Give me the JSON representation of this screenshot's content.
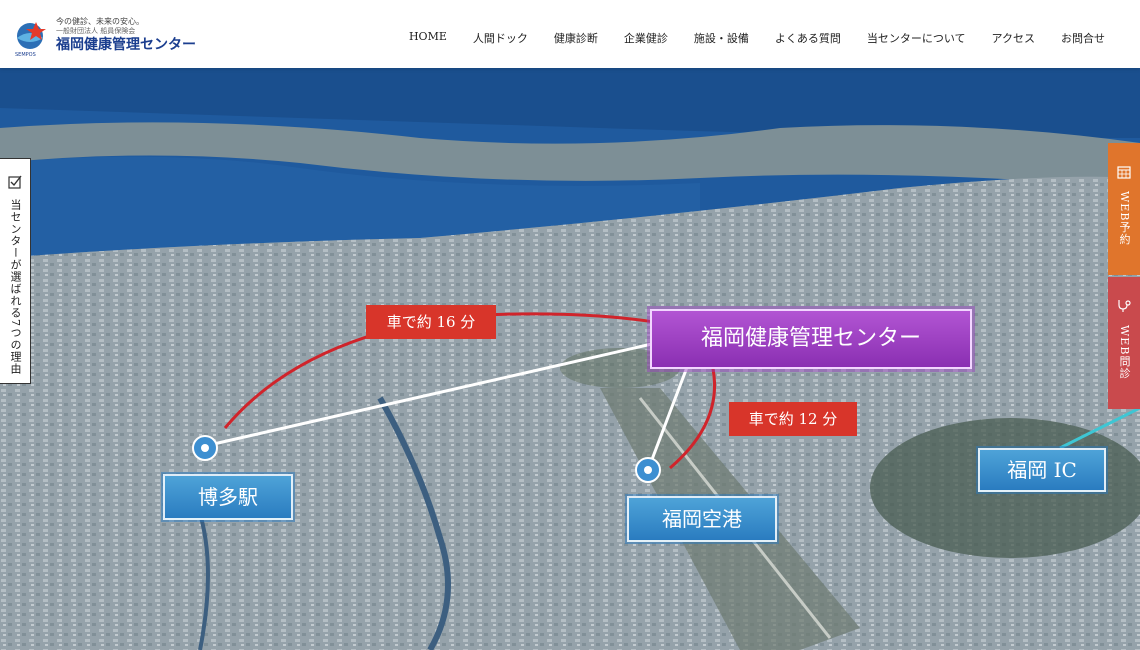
{
  "header": {
    "tagline": "今の健診、未来の安心。",
    "org": "一般財団法人 船員保険会",
    "brand": "福岡健康管理センター",
    "logo_caption": "SEMPOS"
  },
  "nav": [
    {
      "label": "HOME"
    },
    {
      "label": "人間ドック"
    },
    {
      "label": "健康診断"
    },
    {
      "label": "企業健診"
    },
    {
      "label": "施設・設備"
    },
    {
      "label": "よくある質問"
    },
    {
      "label": "当センターについて"
    },
    {
      "label": "アクセス"
    },
    {
      "label": "お問合せ"
    }
  ],
  "side_tab": {
    "label": "当センターが選ばれる7つの理由"
  },
  "right_tabs": [
    {
      "label": "WEB予約",
      "icon": "calendar-icon",
      "color": "#e0752c"
    },
    {
      "label": "WEB問診",
      "icon": "stethoscope-icon",
      "color": "#c94a4d"
    }
  ],
  "map": {
    "center_label": "福岡健康管理センター",
    "places": [
      {
        "label": "博多駅"
      },
      {
        "label": "福岡空港"
      },
      {
        "label": "福岡 IC"
      }
    ],
    "times": [
      {
        "label": "車で約 16 分"
      },
      {
        "label": "車で約 12 分"
      }
    ]
  }
}
